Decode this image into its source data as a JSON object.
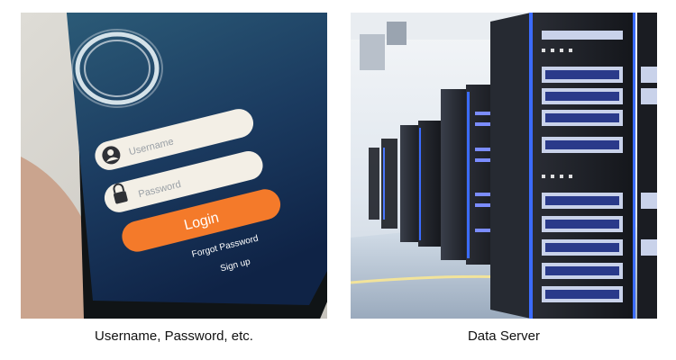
{
  "photos": [
    {
      "caption": "Username, Password, etc.",
      "screen": {
        "username_placeholder": "Username",
        "password_placeholder": "Password",
        "login_label": "Login",
        "forgot_label": "Forgot Password",
        "signup_label": "Sign up"
      },
      "colors": {
        "screen_top": "#2c5c78",
        "screen_bottom": "#0f2346",
        "login_button": "#f47a2a",
        "field": "#f3efe6"
      }
    },
    {
      "caption": "Data Server",
      "colors": {
        "rack_dark": "#1a1c22",
        "led_blue": "#3b6cff",
        "floor_light": "#f2e39a"
      }
    }
  ]
}
